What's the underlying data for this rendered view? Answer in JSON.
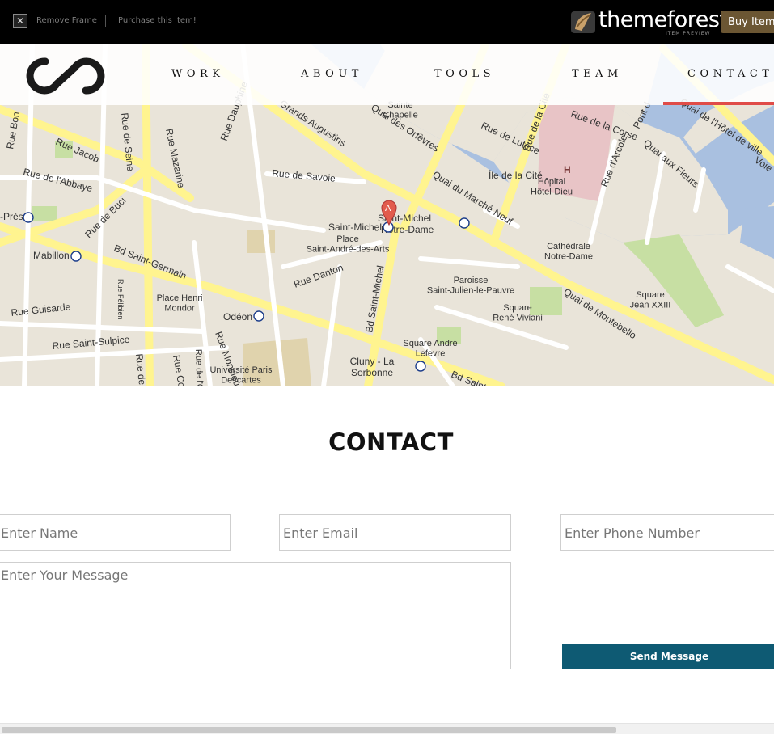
{
  "topbar": {
    "remove_icon": "close-icon",
    "remove_frame_label": "Remove Frame",
    "purchase_label": "Purchase this Item!",
    "brand_name": "themeforest",
    "brand_sub": "ITEM PREVIEW",
    "buy_label": "Buy Item"
  },
  "nav": {
    "items": [
      {
        "label": "WORK"
      },
      {
        "label": "ABOUT"
      },
      {
        "label": "TOOLS"
      },
      {
        "label": "TEAM"
      },
      {
        "label": "CONTACT"
      }
    ],
    "active": "CONTACT",
    "accent_color": "#e04c48"
  },
  "map": {
    "marker_label": "A",
    "labels": {
      "rue_jacob": "Rue Jacob",
      "rue_abbaye": "Rue de l'Abbaye",
      "rue_buci": "Rue de Buci",
      "rue_seine": "Rue de Seine",
      "rue_mazarine": "Rue Mazarine",
      "rue_dauphine": "Rue Dauphine",
      "grands_augustins": "Grands Augustins",
      "rue_savoie": "Rue de Savoie",
      "quai_orfevres": "Quai des Orfèvres",
      "sainte_chapelle": "Sainte\nChapelle",
      "rue_lutece": "Rue de Lutèce",
      "rue_cite": "Rue de la Cité",
      "rue_corse": "Rue de la Corse",
      "ile_cite": "Île de la Cité",
      "hopital": "Hôpital\nHôtel-Dieu",
      "quai_marche_neuf": "Quai du Marché Neuf",
      "rue_arcole": "Rue d'Arcole",
      "quai_fleurs": "Quai aux Fleurs",
      "rue_hotel_ville": "Quai de l'Hôtel de ville",
      "saint_michel": "Saint-Michel",
      "saint_michel_nd": "Saint-Michel\n- Notre-Dame",
      "place_st_andre": "Place\nSaint-André-des-Arts",
      "cathedrale": "Cathédrale\nNotre-Dame",
      "square_jean": "Square\nJean XXIII",
      "mabillon": "Mabillon",
      "bd_saint_germain": "Bd Saint-Germain",
      "rue_danton": "Rue Danton",
      "bd_saint_michel": "Bd Saint-Michel",
      "paroisse": "Paroisse\nSaint-Julien-le-Pauvre",
      "square_rene": "Square\nRené Viviani",
      "quai_montebello": "Quai de Montebello",
      "rue_guisarde": "Rue Guisarde",
      "place_henri": "Place Henri\nMondor",
      "odeon": "Odéon",
      "rue_felibien": "Rue Félibien",
      "rue_saint_sulpice": "Rue Saint-Sulpice",
      "square_andre": "Square André\nLefevre",
      "universite": "Université Paris\nDescartes",
      "cluny": "Cluny - La\nSorbonne",
      "bd_saint_short": "Bd Saint-",
      "pres": "-Prés",
      "rue_bon": "Rue Bon",
      "rue_conde": "Rue Condé",
      "rue_monsieur": "Rue Monsieur",
      "rue_ode": "Rue de l'O",
      "rue_de": "Rue de",
      "voie": "Voie",
      "pont": "Pont d"
    }
  },
  "contact": {
    "title": "CONTACT",
    "name_placeholder": "Enter Name",
    "email_placeholder": "Enter Email",
    "phone_placeholder": "Enter Phone Number",
    "message_placeholder": "Enter Your Message",
    "send_label": "Send Message",
    "button_color": "#0e5a73"
  }
}
